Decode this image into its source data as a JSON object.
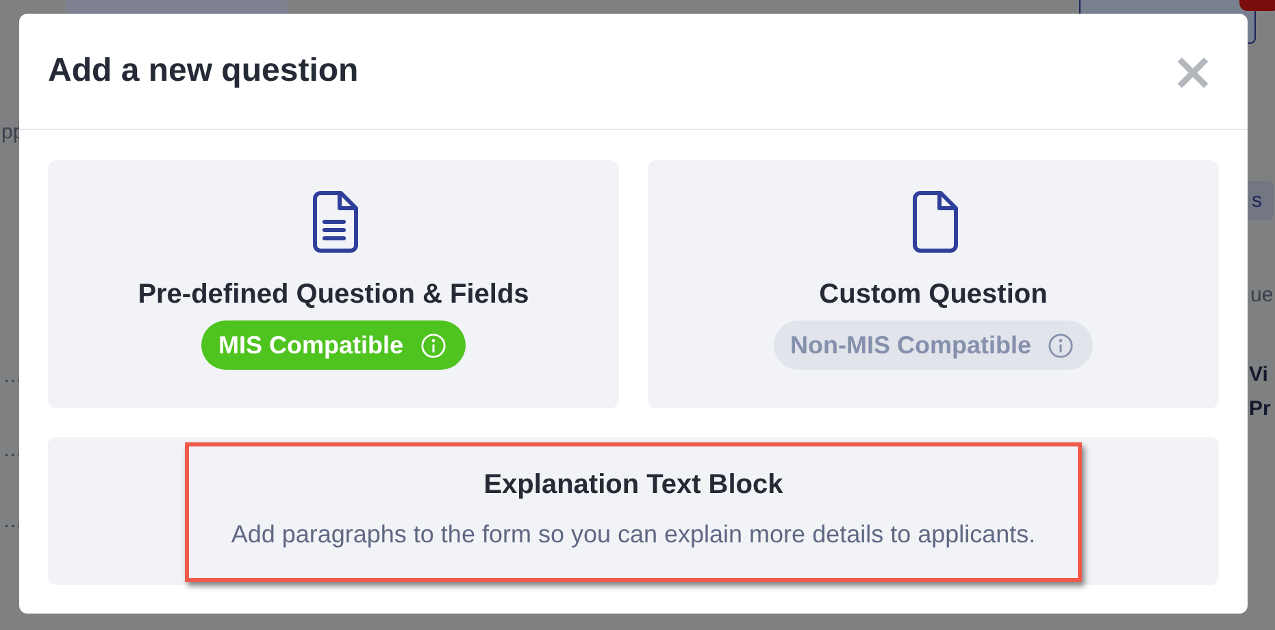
{
  "background": {
    "items": [
      {
        "kind": "fragment",
        "text": "pp"
      },
      {
        "kind": "fragment",
        "text": "…"
      },
      {
        "kind": "fragment",
        "text": "…"
      },
      {
        "kind": "fragment",
        "text": "…"
      },
      {
        "kind": "chip",
        "text": "s"
      },
      {
        "kind": "fragment",
        "text": "ue"
      },
      {
        "kind": "heading",
        "text": "Vi"
      },
      {
        "kind": "heading",
        "text": "Pr"
      }
    ]
  },
  "dialog": {
    "title": "Add a new question",
    "close": "×",
    "options": [
      {
        "kind": "fields",
        "title": "Pre-defined Question & Fields",
        "badge": {
          "text": "MIS Compatible",
          "compatible": true
        },
        "highlighted": false
      },
      {
        "kind": "blank",
        "title": "Custom Question",
        "badge": {
          "text": "Non-MIS Compatible",
          "compatible": false
        },
        "highlighted": false
      },
      {
        "kind": "text",
        "title": "Explanation Text Block",
        "description": "Add paragraphs to the form so you can explain more details to applicants.",
        "highlighted": true
      }
    ]
  }
}
